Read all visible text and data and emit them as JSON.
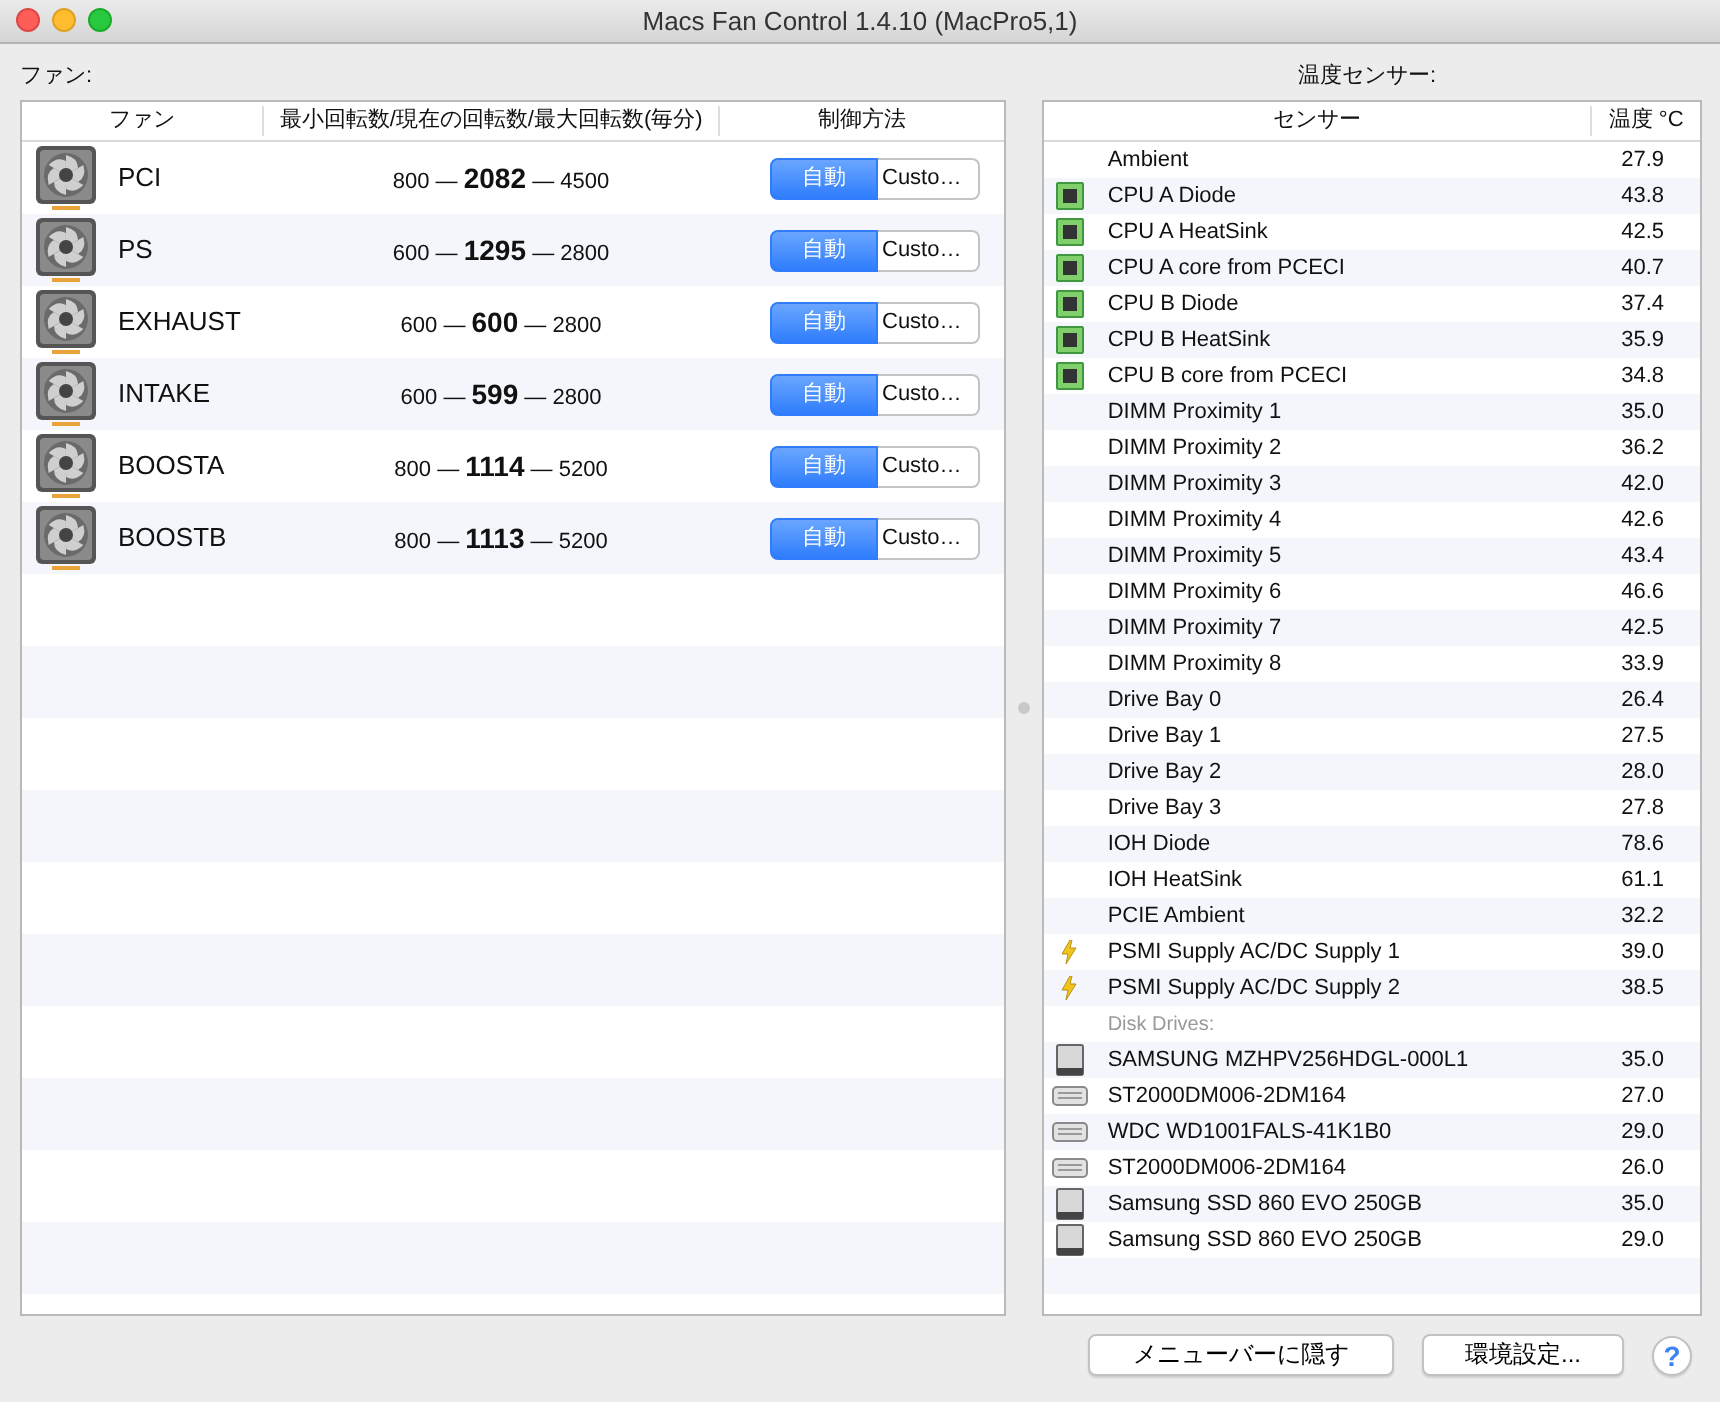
{
  "window": {
    "title": "Macs Fan Control 1.4.10 (MacPro5,1)"
  },
  "fans_label": "ファン:",
  "sensors_label": "温度センサー:",
  "fan_table": {
    "columns": [
      "ファン",
      "最小回転数/現在の回転数/最大回転数(毎分)",
      "制御方法"
    ],
    "rows": [
      {
        "name": "PCI",
        "rpm": "800 — **2082** — 4500",
        "controls": [
          {
            "label": "自動",
            "selected": true
          },
          {
            "label": "Custo…",
            "selected": false
          }
        ]
      },
      {
        "name": "PS",
        "rpm": "600 — **1295** — 2800",
        "controls": [
          {
            "label": "自動",
            "selected": true
          },
          {
            "label": "Custo…",
            "selected": false
          }
        ]
      },
      {
        "name": "EXHAUST",
        "rpm": "600 — **600** — 2800",
        "controls": [
          {
            "label": "自動",
            "selected": true
          },
          {
            "label": "Custo…",
            "selected": false
          }
        ]
      },
      {
        "name": "INTAKE",
        "rpm": "600 — **599** — 2800",
        "controls": [
          {
            "label": "自動",
            "selected": true
          },
          {
            "label": "Custo…",
            "selected": false
          }
        ]
      },
      {
        "name": "BOOSTA",
        "rpm": "800 — **1114** — 5200",
        "controls": [
          {
            "label": "自動",
            "selected": true
          },
          {
            "label": "Custo…",
            "selected": false
          }
        ]
      },
      {
        "name": "BOOSTB",
        "rpm": "800 — **1113** — 5200",
        "controls": [
          {
            "label": "自動",
            "selected": true
          },
          {
            "label": "Custo…",
            "selected": false
          }
        ]
      }
    ]
  },
  "sensor_table": {
    "columns": [
      "センサー",
      "温度 °C"
    ],
    "rows": [
      {
        "kind": "plain",
        "name": "Ambient",
        "value": "27.9"
      },
      {
        "kind": "cpu",
        "name": "CPU A Diode",
        "value": "43.8"
      },
      {
        "kind": "cpu",
        "name": "CPU A HeatSink",
        "value": "42.5"
      },
      {
        "kind": "cpu",
        "name": "CPU A core from PCECI",
        "value": "40.7"
      },
      {
        "kind": "cpu",
        "name": "CPU B Diode",
        "value": "37.4"
      },
      {
        "kind": "cpu",
        "name": "CPU B HeatSink",
        "value": "35.9"
      },
      {
        "kind": "cpu",
        "name": "CPU B core from PCECI",
        "value": "34.8"
      },
      {
        "kind": "plain",
        "name": "DIMM Proximity 1",
        "value": "35.0"
      },
      {
        "kind": "plain",
        "name": "DIMM Proximity 2",
        "value": "36.2"
      },
      {
        "kind": "plain",
        "name": "DIMM Proximity 3",
        "value": "42.0"
      },
      {
        "kind": "plain",
        "name": "DIMM Proximity 4",
        "value": "42.6"
      },
      {
        "kind": "plain",
        "name": "DIMM Proximity 5",
        "value": "43.4"
      },
      {
        "kind": "plain",
        "name": "DIMM Proximity 6",
        "value": "46.6"
      },
      {
        "kind": "plain",
        "name": "DIMM Proximity 7",
        "value": "42.5"
      },
      {
        "kind": "plain",
        "name": "DIMM Proximity 8",
        "value": "33.9"
      },
      {
        "kind": "plain",
        "name": "Drive Bay 0",
        "value": "26.4"
      },
      {
        "kind": "plain",
        "name": "Drive Bay 1",
        "value": "27.5"
      },
      {
        "kind": "plain",
        "name": "Drive Bay 2",
        "value": "28.0"
      },
      {
        "kind": "plain",
        "name": "Drive Bay 3",
        "value": "27.8"
      },
      {
        "kind": "plain",
        "name": "IOH Diode",
        "value": "78.6"
      },
      {
        "kind": "plain",
        "name": "IOH HeatSink",
        "value": "61.1"
      },
      {
        "kind": "plain",
        "name": "PCIE Ambient",
        "value": "32.2"
      },
      {
        "kind": "power",
        "name": "PSMI Supply AC/DC Supply 1",
        "value": "39.0"
      },
      {
        "kind": "power",
        "name": "PSMI Supply AC/DC Supply 2",
        "value": "38.5"
      },
      {
        "kind": "group",
        "name": "Disk Drives:"
      },
      {
        "kind": "ssd",
        "name": "SAMSUNG MZHPV256HDGL-000L1",
        "value": "35.0"
      },
      {
        "kind": "hdd",
        "name": "ST2000DM006-2DM164",
        "value": "27.0"
      },
      {
        "kind": "hdd",
        "name": "WDC WD1001FALS-41K1B0",
        "value": "29.0"
      },
      {
        "kind": "hdd",
        "name": "ST2000DM006-2DM164",
        "value": "26.0"
      },
      {
        "kind": "ssd",
        "name": "Samsung SSD 860 EVO 250GB",
        "value": "35.0"
      },
      {
        "kind": "ssd",
        "name": "Samsung SSD 860 EVO 250GB",
        "value": "29.0"
      }
    ]
  },
  "buttons": [
    {
      "kind": "text",
      "label": "メニューバーに隠す"
    },
    {
      "kind": "text",
      "label": "環境設定..."
    },
    {
      "kind": "help",
      "label": "?"
    }
  ]
}
